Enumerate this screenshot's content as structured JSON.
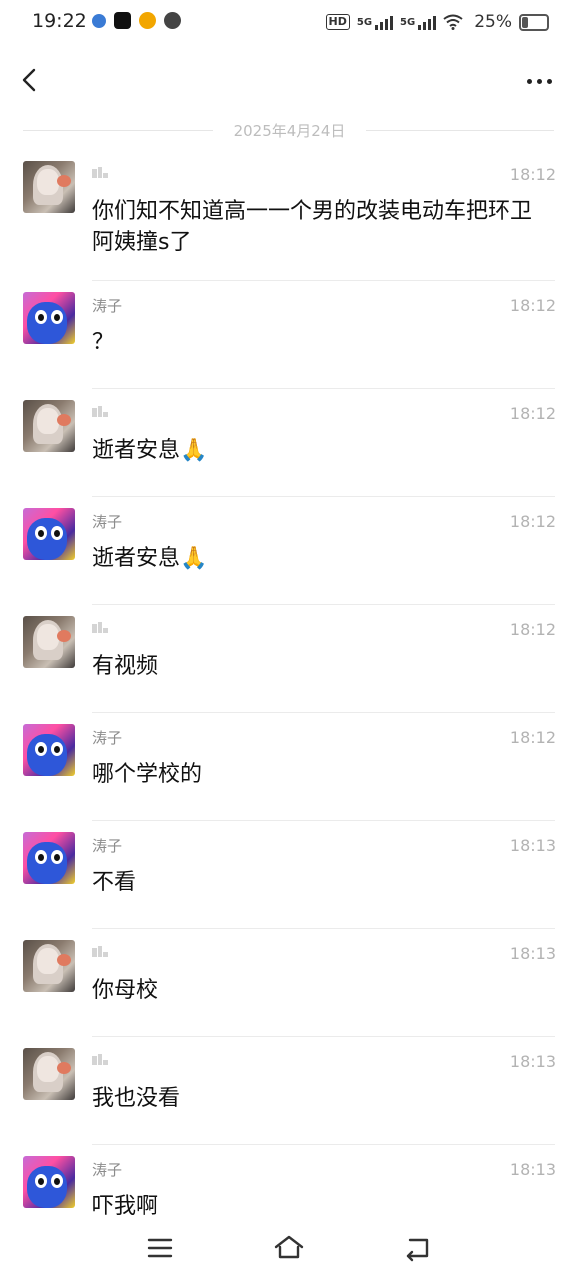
{
  "status_bar": {
    "time": "19:22",
    "hd_label": "HD",
    "net1": "5G",
    "net2": "5G",
    "battery": "25%"
  },
  "header": {
    "back_icon": "chevron-left-icon",
    "more_icon": "more-horizontal-icon"
  },
  "date_divider": "2025年4月24日",
  "messages": [
    {
      "sender": "",
      "avatar": "girl",
      "time": "18:12",
      "text": "你们知不知道高一一个男的改装电动车把环卫阿姨撞s了"
    },
    {
      "sender": "涛子",
      "avatar": "monster",
      "time": "18:12",
      "text": "？"
    },
    {
      "sender": "",
      "avatar": "girl",
      "time": "18:12",
      "text": "逝者安息🙏"
    },
    {
      "sender": "涛子",
      "avatar": "monster",
      "time": "18:12",
      "text": "逝者安息🙏"
    },
    {
      "sender": "",
      "avatar": "girl",
      "time": "18:12",
      "text": "有视频"
    },
    {
      "sender": "涛子",
      "avatar": "monster",
      "time": "18:12",
      "text": "哪个学校的"
    },
    {
      "sender": "涛子",
      "avatar": "monster",
      "time": "18:13",
      "text": "不看"
    },
    {
      "sender": "",
      "avatar": "girl",
      "time": "18:13",
      "text": "你母校"
    },
    {
      "sender": "",
      "avatar": "girl",
      "time": "18:13",
      "text": "我也没看"
    },
    {
      "sender": "涛子",
      "avatar": "monster",
      "time": "18:13",
      "text": "吓我啊"
    }
  ],
  "nav_bar": {
    "menu_icon": "menu-icon",
    "home_icon": "home-icon",
    "back_icon": "back-icon"
  }
}
